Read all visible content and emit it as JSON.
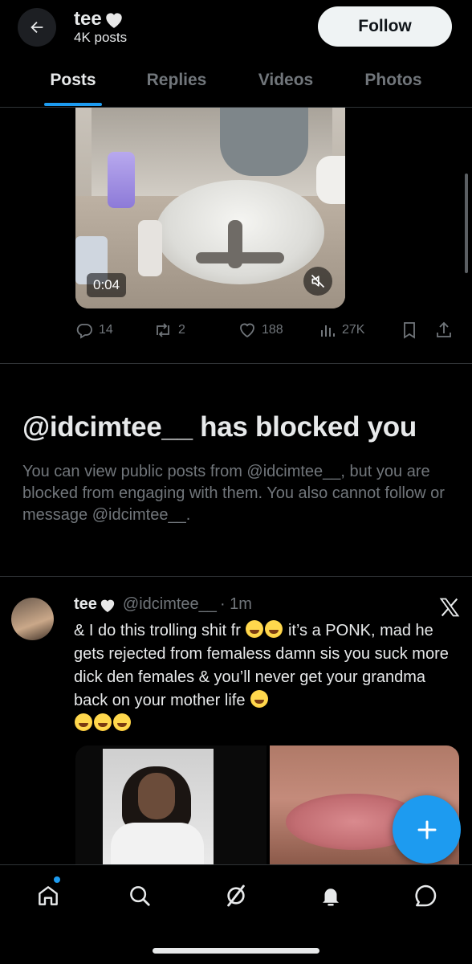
{
  "header": {
    "back_icon": "arrow-left-icon",
    "name": "tee",
    "heart_icon": "white-heart-emoji",
    "post_count": "4K posts",
    "follow_label": "Follow"
  },
  "tabs": [
    {
      "label": "Posts",
      "active": true
    },
    {
      "label": "Replies",
      "active": false
    },
    {
      "label": "Videos",
      "active": false
    },
    {
      "label": "Photos",
      "active": false
    }
  ],
  "video_post": {
    "duration": "0:04",
    "mute_icon": "speaker-muted-icon",
    "replies": "14",
    "reposts": "2",
    "likes": "188",
    "views": "27K"
  },
  "blocked": {
    "title": "@idcimtee__ has blocked you",
    "body": "You can view public posts from @idcimtee__, but you are blocked from engaging with them. You also cannot follow or message @idcimtee__."
  },
  "post": {
    "name": "tee",
    "handle": "@idcimtee__",
    "time": "· 1m",
    "text_before": "& I do this trolling shit fr ",
    "text_middle": " it’s a PONK, mad he gets rejected from femaless damn sis you suck more dick den females & you’ll never get your grandma back on your mother life ",
    "emoji_rofl": "rolling-on-floor-laughing-emoji",
    "emoji_joy": "face-with-tears-of-joy-emoji"
  },
  "fab_icon": "plus-icon",
  "nav": [
    {
      "name": "home-icon",
      "badge": true
    },
    {
      "name": "search-icon",
      "badge": false
    },
    {
      "name": "grok-icon",
      "badge": false
    },
    {
      "name": "bell-icon",
      "badge": false
    },
    {
      "name": "message-icon",
      "badge": false
    }
  ],
  "colors": {
    "accent": "#1d9bf0",
    "background": "#000000",
    "text": "#e7e9ea",
    "muted": "#71767b"
  }
}
